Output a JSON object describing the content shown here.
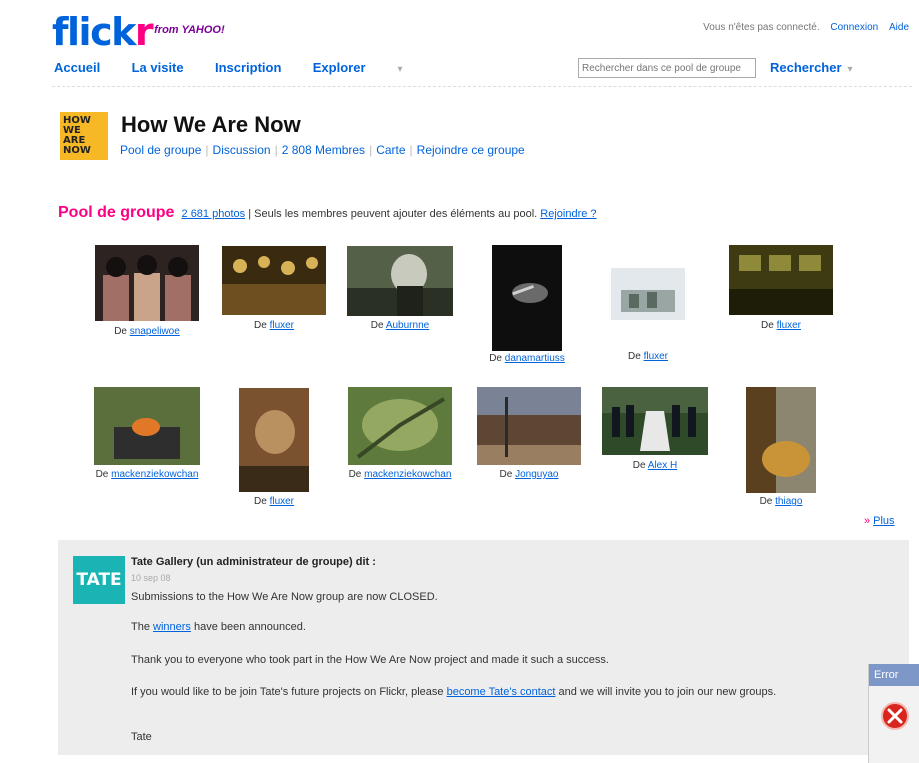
{
  "header": {
    "logo_text_a": "flick",
    "logo_text_b": "r",
    "logo_sub": "from YAHOO!",
    "signin_text": "Vous n'êtes pas connecté.",
    "signin_link": "Connexion",
    "help_link": "Aide",
    "nav": [
      "Accueil",
      "La visite",
      "Inscription",
      "Explorer"
    ],
    "search_placeholder": "Rechercher dans ce pool de groupe",
    "search_button": "Rechercher"
  },
  "group": {
    "icon_lines": [
      "HOW",
      "WE",
      "ARE",
      "NOW"
    ],
    "title": "How We Are Now",
    "nav": [
      "Pool de groupe",
      "Discussion",
      "2 808 Membres",
      "Carte",
      "Rejoindre ce groupe"
    ]
  },
  "pool": {
    "title": "Pool de groupe",
    "count_link": "2 681 photos",
    "sep": "|",
    "note": "Seuls les membres peuvent ajouter des éléments au pool.",
    "join_link": "Rejoindre ?",
    "prefix": "De",
    "photos": [
      {
        "author": "snapeliwoe",
        "palette": [
          "#2d2320",
          "#c9a38a",
          "#a26f66"
        ]
      },
      {
        "author": "fluxer",
        "palette": [
          "#3a2a10",
          "#d8b256",
          "#6e5020"
        ]
      },
      {
        "author": "Auburnne",
        "palette": [
          "#556048",
          "#c8cabd",
          "#2a3024"
        ]
      },
      {
        "author": "danamartiuss",
        "palette": [
          "#0e0e0e",
          "#6a6a6a",
          "#d0d0d0"
        ]
      },
      {
        "author": "fluxer",
        "palette": [
          "#e2e8ec",
          "#5b6a60",
          "#9aa6a4"
        ]
      },
      {
        "author": "fluxer",
        "palette": [
          "#3e3b12",
          "#8e8a3a",
          "#1e1e08"
        ]
      },
      {
        "author": "mackenziekowchan",
        "palette": [
          "#5b6f3c",
          "#2e2e2e",
          "#e07828"
        ]
      },
      {
        "author": "fluxer",
        "palette": [
          "#7a5230",
          "#b99060",
          "#3a2a18"
        ]
      },
      {
        "author": "mackenziekowchan",
        "palette": [
          "#5e7a3c",
          "#94a862",
          "#384826"
        ]
      },
      {
        "author": "Jonguyao",
        "palette": [
          "#7a8296",
          "#5e4634",
          "#9a7e62"
        ]
      },
      {
        "author": "Alex H",
        "palette": [
          "#2f4a28",
          "#e8e8e8",
          "#12161e"
        ]
      },
      {
        "author": "thiago",
        "palette": [
          "#5b4020",
          "#c99438",
          "#8c8670"
        ]
      }
    ]
  },
  "more_link": "Plus",
  "discussion": {
    "logo": "TATE",
    "poster": "Tate Gallery (un administrateur de groupe) dit :",
    "date": "10 sep 08",
    "p1": "Submissions to the How We Are Now group are now CLOSED.",
    "p2_a": "The",
    "p2_link": "winners",
    "p2_b": "have been announced.",
    "p3": "Thank you to everyone who took part in the How We Are Now project and made it such a success.",
    "p4_a": "If you would like to be join Tate's future projects on Flickr, please",
    "p4_link": "become Tate's contact",
    "p4_b": "and we will invite you to join our new groups.",
    "p5": "Tate"
  },
  "error_tab": {
    "label": "Error"
  },
  "colors": {
    "flickr_blue": "#0063dc",
    "flickr_pink": "#ff0084",
    "tate_teal": "#1ab4b4",
    "group_icon_yellow": "#f6b824",
    "error_red": "#d8261f"
  }
}
